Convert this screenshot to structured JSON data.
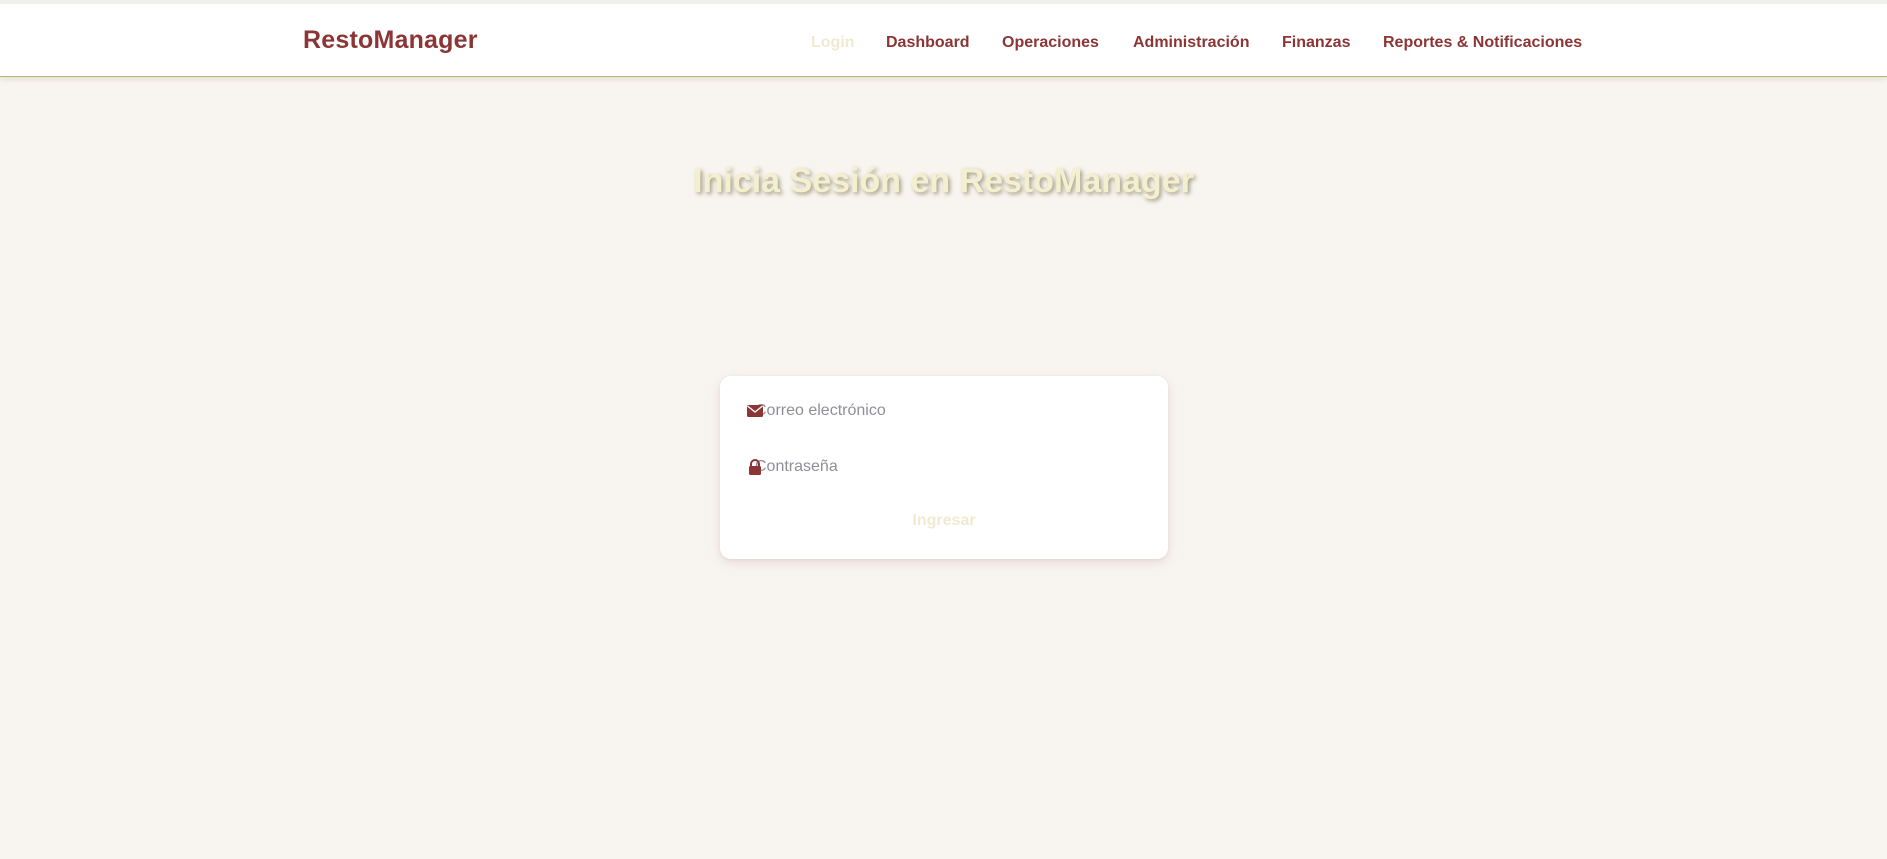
{
  "header": {
    "brand": "RestoManager",
    "nav": [
      {
        "label": "Login",
        "active": true
      },
      {
        "label": "Dashboard",
        "active": false
      },
      {
        "label": "Operaciones",
        "active": false
      },
      {
        "label": "Administración",
        "active": false
      },
      {
        "label": "Finanzas",
        "active": false
      },
      {
        "label": "Reportes & Notificaciones",
        "active": false
      }
    ]
  },
  "main": {
    "title": "Inicia Sesión en RestoManager"
  },
  "login_form": {
    "email": {
      "placeholder": "Correo electrónico",
      "value": "",
      "icon": "envelope-icon"
    },
    "password": {
      "placeholder": "Contraseña",
      "value": "",
      "icon": "lock-icon"
    },
    "submit_label": "Ingresar"
  },
  "colors": {
    "brand": "#8c3535",
    "page_bg": "#f8f5f0",
    "active_nav": "#f1ead0",
    "title": "#f3efcf"
  }
}
